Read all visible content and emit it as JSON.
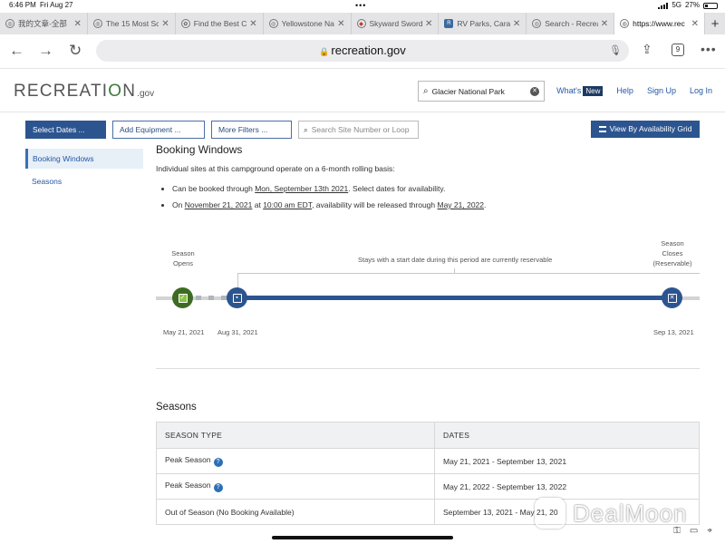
{
  "status": {
    "time": "6:46 PM",
    "date": "Fri Aug 27",
    "network": "5G",
    "battery": "27%"
  },
  "tabs": [
    {
      "title": "我的文章-全部",
      "active": false
    },
    {
      "title": "The 15 Most Sc",
      "active": false
    },
    {
      "title": "Find the Best C",
      "active": false
    },
    {
      "title": "Yellowstone Na",
      "active": false
    },
    {
      "title": "Skyward Sword",
      "active": false
    },
    {
      "title": "RV Parks, Cara",
      "active": false
    },
    {
      "title": "Search - Recrea",
      "active": false
    },
    {
      "title": "https://www.rec",
      "active": true
    }
  ],
  "browser": {
    "url": "recreation.gov",
    "tab_count": "9"
  },
  "site": {
    "logo_main": "RECREATI",
    "logo_o": "O",
    "logo_end": "N",
    "logo_gov": ".gov",
    "search_value": "Glacier National Park",
    "links": {
      "whats": "What's",
      "new_badge": "New",
      "help": "Help",
      "signup": "Sign Up",
      "login": "Log In"
    }
  },
  "filters": {
    "select_dates": "Select Dates ...",
    "add_equipment": "Add Equipment ...",
    "more_filters": "More Filters ...",
    "site_search_placeholder": "Search Site Number or Loop",
    "availability_grid": "View By Availability Grid"
  },
  "sidebar": {
    "items": [
      {
        "label": "Booking Windows"
      },
      {
        "label": "Seasons"
      }
    ]
  },
  "booking": {
    "title": "Booking Windows",
    "intro": "Individual sites at this campground operate on a 6-month rolling basis:",
    "b1_pre": "Can be booked through ",
    "b1_link": "Mon, September 13th 2021",
    "b1_post": ". Select dates for availability.",
    "b2_pre": "On ",
    "b2_link1": "November 21, 2021",
    "b2_mid1": " at ",
    "b2_link2": "10:00 am EDT",
    "b2_mid2": ", availability will be released through ",
    "b2_link3": "May 21, 2022",
    "b2_post": "."
  },
  "timeline": {
    "opens_line1": "Season",
    "opens_line2": "Opens",
    "closes_line1": "Season",
    "closes_line2": "Closes",
    "closes_line3": "(Reservable)",
    "span_label": "Stays with a start date during this period are currently reservable",
    "date_open": "May 21, 2021",
    "date_today": "Aug 31, 2021",
    "date_close": "Sep 13, 2021"
  },
  "seasons": {
    "title": "Seasons",
    "headers": [
      "SEASON TYPE",
      "DATES"
    ],
    "rows": [
      {
        "type": "Peak Season",
        "help": "?",
        "dates": "May 21, 2021 - September 13, 2021"
      },
      {
        "type": "Peak Season",
        "help": "?",
        "dates": "May 21, 2022 - September 13, 2022"
      },
      {
        "type": "Out of Season (No Booking Available)",
        "help": "",
        "dates": "September 13, 2021 - May 21, 20"
      }
    ]
  },
  "watermark": {
    "text": "DealMoon"
  }
}
